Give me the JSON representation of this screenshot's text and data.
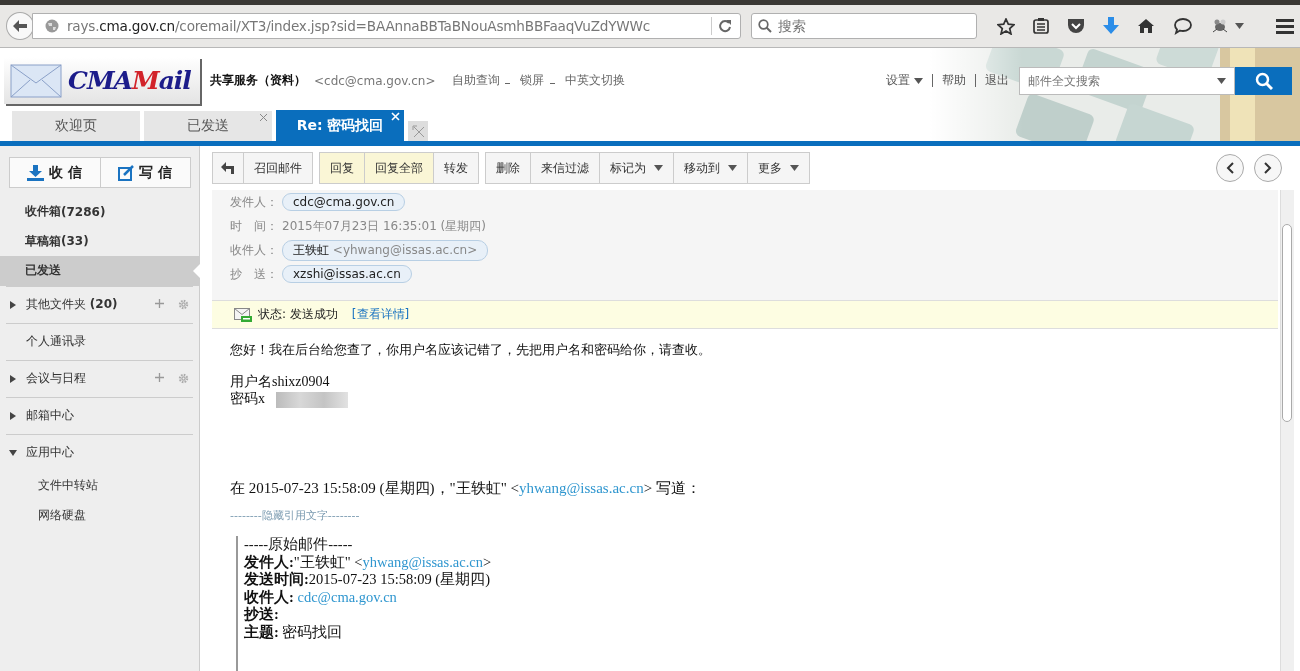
{
  "browser": {
    "url": {
      "prefix": "rays.",
      "domain": "cma.gov.cn",
      "rest": "/coremail/XT3/index.jsp?sid=BAAnnaBBTaBNouAsmhBBFaaqVuZdYWWc"
    },
    "search_placeholder": "搜索"
  },
  "header": {
    "logo": [
      {
        "text": "CMA",
        "color": "#1c1c8a"
      },
      {
        "text": "M",
        "color": "#d2232a"
      },
      {
        "text": "ail",
        "color": "#1c1c8a"
      }
    ],
    "account": {
      "name": "共享服务（资料）",
      "email": "<cdc@cma.gov.cn>"
    },
    "links": [
      "自助查询",
      "锁屏",
      "中英文切换"
    ],
    "menu": [
      {
        "label": "设置",
        "dropdown": true
      },
      {
        "label": "帮助",
        "dropdown": false
      },
      {
        "label": "退出",
        "dropdown": false
      }
    ],
    "search_placeholder": "邮件全文搜索"
  },
  "tabs": [
    {
      "label": "欢迎页",
      "closable": false,
      "selected": false
    },
    {
      "label": "已发送",
      "closable": true,
      "selected": false
    },
    {
      "label": "Re: 密码找回",
      "closable": true,
      "selected": true
    }
  ],
  "sidebar": {
    "receive": "收 信",
    "compose": "写 信",
    "folders": [
      {
        "label": "收件箱",
        "count": "(7286)",
        "selected": false
      },
      {
        "label": "草稿箱",
        "count": "(33)",
        "selected": false
      },
      {
        "label": "已发送",
        "selected": true
      }
    ],
    "sections": [
      {
        "kind": "group",
        "label": "其他文件夹",
        "count": "(20)",
        "expanded": false,
        "tools": true
      },
      {
        "kind": "link",
        "label": "个人通讯录"
      },
      {
        "kind": "group",
        "label": "会议与日程",
        "expanded": false,
        "tools": true
      },
      {
        "kind": "group",
        "label": "邮箱中心",
        "expanded": false,
        "tools": false
      },
      {
        "kind": "group",
        "label": "应用中心",
        "expanded": true,
        "tools": false,
        "children": [
          {
            "label": "文件中转站"
          },
          {
            "label": "网络硬盘"
          }
        ]
      }
    ]
  },
  "toolbar": [
    [
      {
        "kind": "icon",
        "highlighted": false
      },
      {
        "kind": "text",
        "label": "召回邮件",
        "highlighted": false,
        "dropdown": false
      }
    ],
    [
      {
        "kind": "text",
        "label": "回复",
        "highlighted": true,
        "dropdown": false
      },
      {
        "kind": "text",
        "label": "回复全部",
        "highlighted": true,
        "dropdown": false
      },
      {
        "kind": "text",
        "label": "转发",
        "highlighted": false,
        "dropdown": false
      }
    ],
    [
      {
        "kind": "text",
        "label": "删除",
        "highlighted": false,
        "dropdown": false
      },
      {
        "kind": "text",
        "label": "来信过滤",
        "highlighted": false,
        "dropdown": false
      },
      {
        "kind": "text",
        "label": "标记为",
        "highlighted": false,
        "dropdown": true
      },
      {
        "kind": "text",
        "label": "移动到",
        "highlighted": false,
        "dropdown": true
      },
      {
        "kind": "text",
        "label": "更多",
        "highlighted": false,
        "dropdown": true
      }
    ]
  ],
  "mail": {
    "fields": [
      {
        "kind": "chips",
        "label": "发件人：",
        "chips": [
          {
            "address": "cdc@cma.gov.cn"
          }
        ]
      },
      {
        "kind": "text",
        "label": "时　间：",
        "value": "2015年07月23日 16:35:01 (星期四)"
      },
      {
        "kind": "chips",
        "label": "收件人：",
        "chips": [
          {
            "name": "王轶虹",
            "address": "<yhwang@issas.ac.cn>"
          }
        ]
      },
      {
        "kind": "chips",
        "label": "抄　送：",
        "chips": [
          {
            "address": "xzshi@issas.ac.cn"
          }
        ]
      }
    ],
    "status": {
      "text": "状态: 发送成功",
      "link": "[查看详情]"
    },
    "greeting": "您好！我在后台给您查了，你用户名应该记错了，先把用户名和密码给你，请查收。",
    "credentials": [
      "用户名shixz0904",
      "密码x"
    ],
    "quote_intro": {
      "before": "在 2015-07-23 15:58:09 (星期四)，\"王轶虹\" <",
      "link": "yhwang@issas.ac.cn",
      "after": "> 写道："
    },
    "hidden_quote": "--------隐藏引用文字--------",
    "quote_title": "-----原始邮件-----",
    "quote_lines": [
      {
        "label": "发件人:",
        "text": "\"王轶虹\" <",
        "link": "yhwang@issas.ac.cn",
        "after": ">"
      },
      {
        "label": "发送时间:",
        "text": "2015-07-23 15:58:09 (星期四)"
      },
      {
        "label": "收件人: ",
        "link": "cdc@cma.gov.cn"
      },
      {
        "label": "抄送:"
      },
      {
        "label": "主题: ",
        "text": "密码找回"
      }
    ]
  }
}
